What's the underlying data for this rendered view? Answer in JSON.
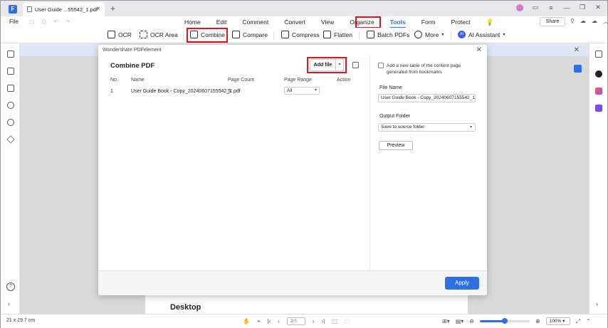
{
  "titlebar": {
    "tab_title": "User Guide ...55542_1.pdf",
    "new_tab_icon": "plus-icon"
  },
  "menubar": {
    "file_label": "File",
    "menus": [
      "Home",
      "Edit",
      "Comment",
      "Convert",
      "View",
      "Organize",
      "Tools",
      "Form",
      "Protect"
    ],
    "active_menu": "Tools",
    "share_label": "Share"
  },
  "toolbar": {
    "tools": [
      {
        "label": "OCR",
        "icon": "ocr-icon"
      },
      {
        "label": "OCR Area",
        "icon": "ocr-area-icon"
      },
      {
        "label": "Combine",
        "icon": "combine-icon"
      },
      {
        "label": "Compare",
        "icon": "compare-icon"
      },
      {
        "label": "Compress",
        "icon": "compress-icon"
      },
      {
        "label": "Flatten",
        "icon": "flatten-icon"
      },
      {
        "label": "Batch PDFs",
        "icon": "batch-icon"
      },
      {
        "label": "More",
        "icon": "more-icon"
      },
      {
        "label": "AI Assistant",
        "icon": "ai-assistant-icon"
      }
    ]
  },
  "dialog": {
    "window_title": "Wondershare PDFelement",
    "heading": "Combine PDF",
    "add_file_label": "Add file",
    "columns": [
      "No.",
      "Name",
      "Page Count",
      "Page Range",
      "Action"
    ],
    "rows": [
      {
        "no": "1",
        "name": "User Guide Book - Copy_20240607155542_1.pdf",
        "page_count": "5",
        "page_range": "All"
      }
    ],
    "toc_option_label": "Add a new table of the content page generated from bookmarks",
    "file_name_label": "File Name",
    "file_name_value": "User Guide Book - Copy_20240607155542_1_c",
    "output_folder_label": "Output Folder",
    "output_folder_value": "Save to source folder",
    "preview_label": "Preview",
    "apply_label": "Apply"
  },
  "document": {
    "heading": "Desktop"
  },
  "statusbar": {
    "page_size": "21 x 29.7 cm",
    "current_page": "2",
    "total_pages": "/5",
    "zoom": "100%",
    "zoom_fraction": 0.5
  },
  "colors": {
    "accent": "#2f6fe4",
    "highlight_box": "#e0141c"
  }
}
